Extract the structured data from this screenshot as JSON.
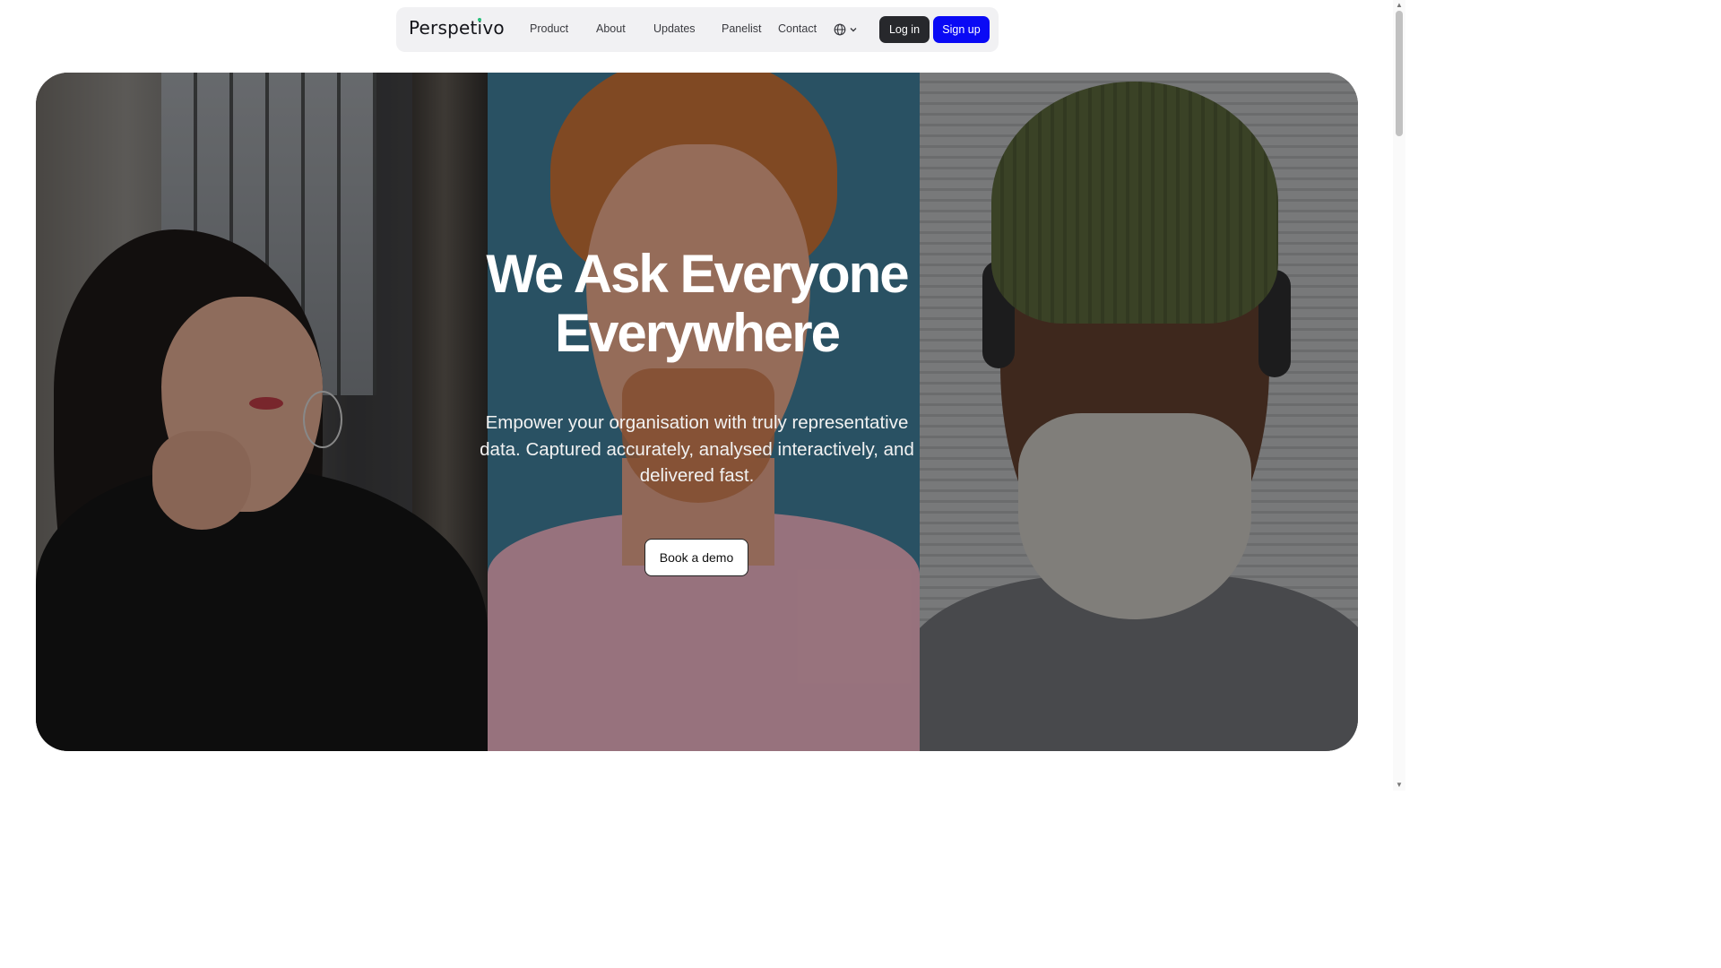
{
  "brand": {
    "name_prefix": "Perspet",
    "name_accent": "i",
    "name_suffix": "vo"
  },
  "nav": {
    "links": [
      "Product",
      "About",
      "Updates",
      "Panelist",
      "Contact"
    ],
    "language_icon": "globe-icon",
    "login_label": "Log in",
    "signup_label": "Sign up"
  },
  "hero": {
    "title_line1": "We Ask Everyone",
    "title_line2": "Everywhere",
    "subtitle": "Empower your organisation with truly representative data. Captured accurately, analysed interactively, and delivered fast.",
    "cta_label": "Book a demo"
  },
  "colors": {
    "signup_bg": "#0a0af5",
    "login_bg": "#27282c",
    "nav_bg": "#f1f1f3",
    "logo_dot": "#27c07a"
  }
}
